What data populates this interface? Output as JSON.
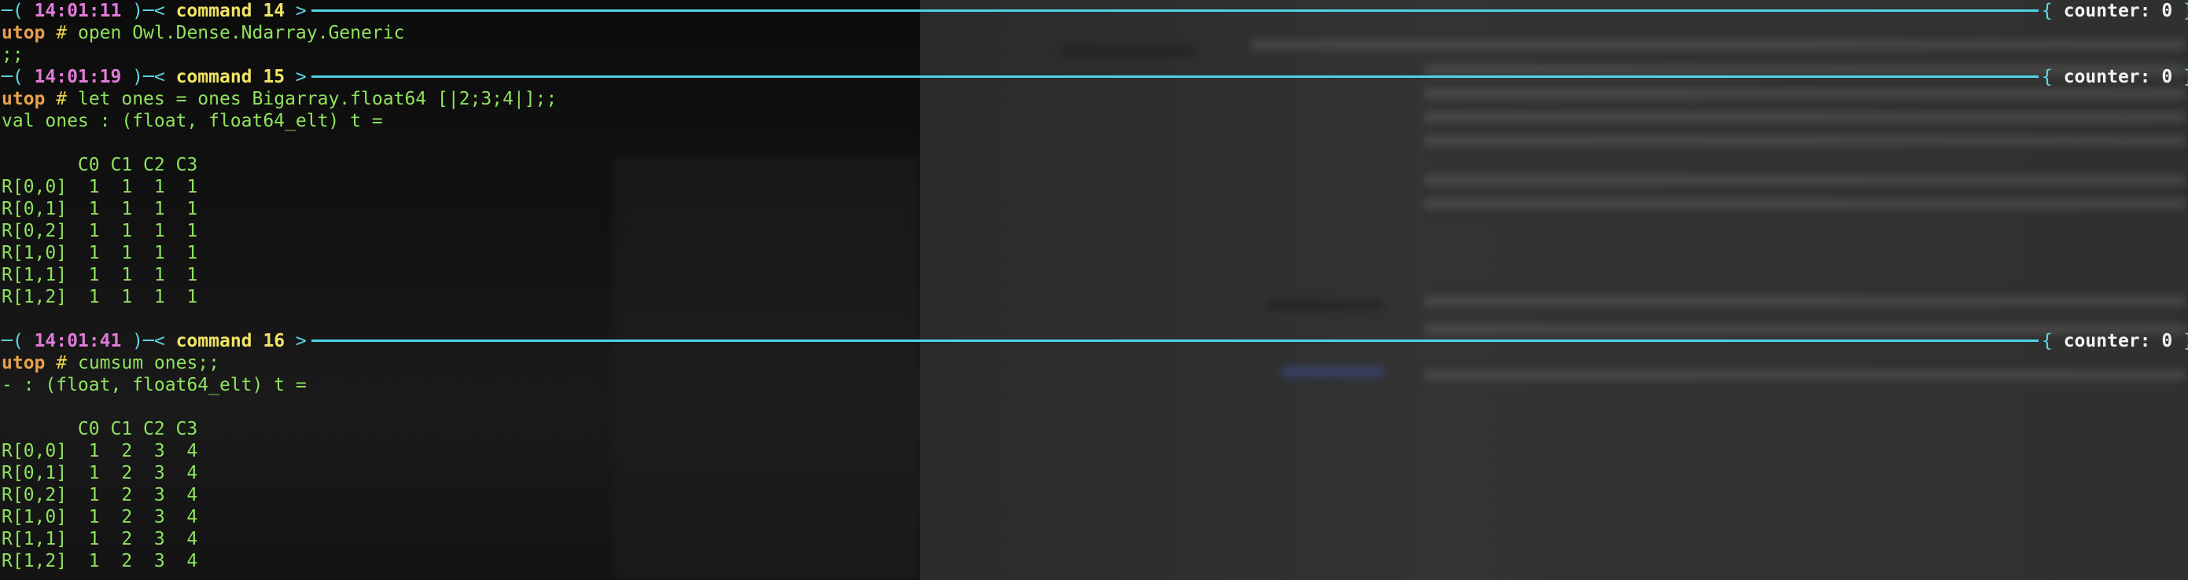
{
  "blocks": [
    {
      "time": "14:01:11",
      "command_label": "command 14",
      "counter": "counter: 0",
      "prompt": "utop",
      "prompt_sym": "#",
      "input": "open Owl.Dense.Ndarray.Generic",
      "output": [
        ";;"
      ]
    },
    {
      "time": "14:01:19",
      "command_label": "command 15",
      "counter": "counter: 0",
      "prompt": "utop",
      "prompt_sym": "#",
      "input": "let ones = ones Bigarray.float64 [|2;3;4|];;",
      "output": [
        "val ones : (float, float64_elt) t =",
        "",
        "       C0 C1 C2 C3",
        "R[0,0]  1  1  1  1",
        "R[0,1]  1  1  1  1",
        "R[0,2]  1  1  1  1",
        "R[1,0]  1  1  1  1",
        "R[1,1]  1  1  1  1",
        "R[1,2]  1  1  1  1"
      ]
    },
    {
      "time": "14:01:41",
      "command_label": "command 16",
      "counter": "counter: 0",
      "prompt": "utop",
      "prompt_sym": "#",
      "input": "cumsum ones;;",
      "output": [
        "- : (float, float64_elt) t =",
        "",
        "       C0 C1 C2 C3",
        "R[0,0]  1  2  3  4",
        "R[0,1]  1  2  3  4",
        "R[0,2]  1  2  3  4",
        "R[1,0]  1  2  3  4",
        "R[1,1]  1  2  3  4",
        "R[1,2]  1  2  3  4"
      ]
    }
  ],
  "colors": {
    "rule": "#4fd3e6",
    "time": "#e07ad8",
    "command": "#f1e463",
    "prompt": "#e8d44d",
    "output": "#8fe35d"
  }
}
